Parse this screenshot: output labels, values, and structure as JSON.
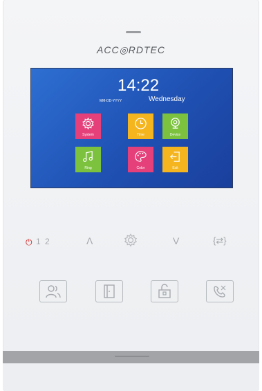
{
  "device": {
    "brand": "ACC◎RDTEC"
  },
  "screen": {
    "time": "14:22",
    "date_placeholder": "MM-DD-YYYY",
    "weekday": "Wednesday",
    "menu": [
      {
        "label": "System",
        "icon": "gear-icon",
        "color": "#e5407a"
      },
      {
        "label": "Time",
        "icon": "clock-icon",
        "color": "#f4b51e"
      },
      {
        "label": "Device",
        "icon": "camera-icon",
        "color": "#7cc23f"
      },
      {
        "label": "Ring",
        "icon": "music-note-icon",
        "color": "#7cc23f"
      },
      {
        "label": "Color",
        "icon": "palette-icon",
        "color": "#e5407a"
      },
      {
        "label": "Exit",
        "icon": "exit-icon",
        "color": "#f4b51e"
      }
    ]
  },
  "controls": {
    "power_symbol": "⏻",
    "channel_1": "1",
    "channel_2": "2",
    "up_symbol": "Λ",
    "down_symbol": "V",
    "swap_symbol": "{⇄}",
    "power_color": "#d22a2a"
  },
  "buttons": [
    {
      "icon": "users-icon"
    },
    {
      "icon": "door-icon"
    },
    {
      "icon": "unlock-icon"
    },
    {
      "icon": "phone-hangup-icon"
    }
  ]
}
